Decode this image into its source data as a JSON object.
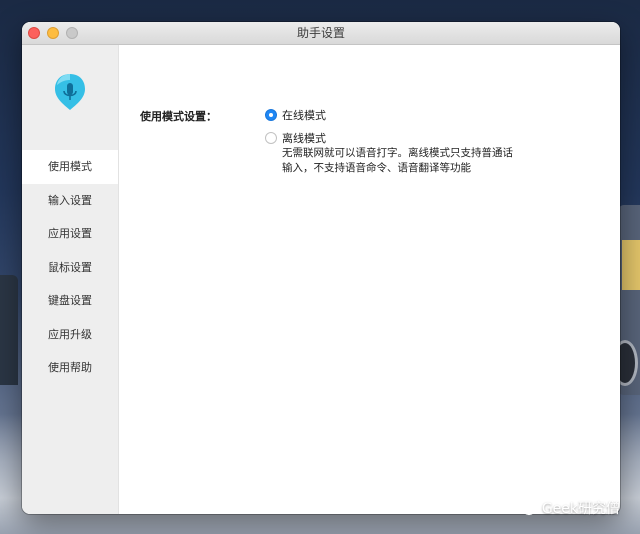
{
  "window": {
    "title": "助手设置"
  },
  "sidebar": {
    "items": [
      {
        "label": "使用模式",
        "active": true
      },
      {
        "label": "输入设置",
        "active": false
      },
      {
        "label": "应用设置",
        "active": false
      },
      {
        "label": "鼠标设置",
        "active": false
      },
      {
        "label": "键盘设置",
        "active": false
      },
      {
        "label": "应用升级",
        "active": false
      },
      {
        "label": "使用帮助",
        "active": false
      }
    ]
  },
  "main": {
    "mode_label": "使用模式设置：",
    "options": [
      {
        "label": "在线模式",
        "checked": true,
        "description": ""
      },
      {
        "label": "离线模式",
        "checked": false,
        "description": "无需联网就可以语音打字。离线模式只支持普通话输入，不支持语音命令、语音翻译等功能"
      }
    ]
  },
  "watermark": {
    "text": "Geek研究僧"
  },
  "colors": {
    "accent": "#1f87f4",
    "logo": "#35bfe6"
  }
}
